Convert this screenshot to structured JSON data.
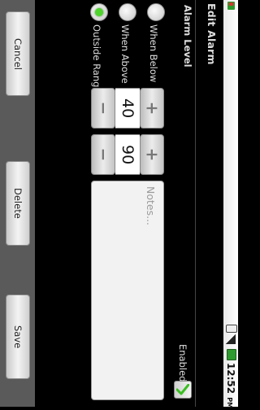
{
  "title": "Edit Alarm",
  "status": {
    "time": "12:52",
    "ampm": "PM"
  },
  "alarm_level": {
    "label": "Alarm Level",
    "options": [
      "When Below",
      "When Above",
      "Outside Range"
    ],
    "selected": "Outside Range"
  },
  "low": {
    "value": "40",
    "minus": "−",
    "plus": "+"
  },
  "high": {
    "value": "90",
    "minus": "−",
    "plus": "+"
  },
  "notes": {
    "placeholder": "Notes...",
    "value": ""
  },
  "enabled": {
    "label": "Enabled",
    "checked": true
  },
  "buttons": {
    "cancel": "Cancel",
    "delete": "Delete",
    "save": "Save"
  },
  "colors": {
    "accent": "#4fd42e",
    "background": "#000000"
  }
}
